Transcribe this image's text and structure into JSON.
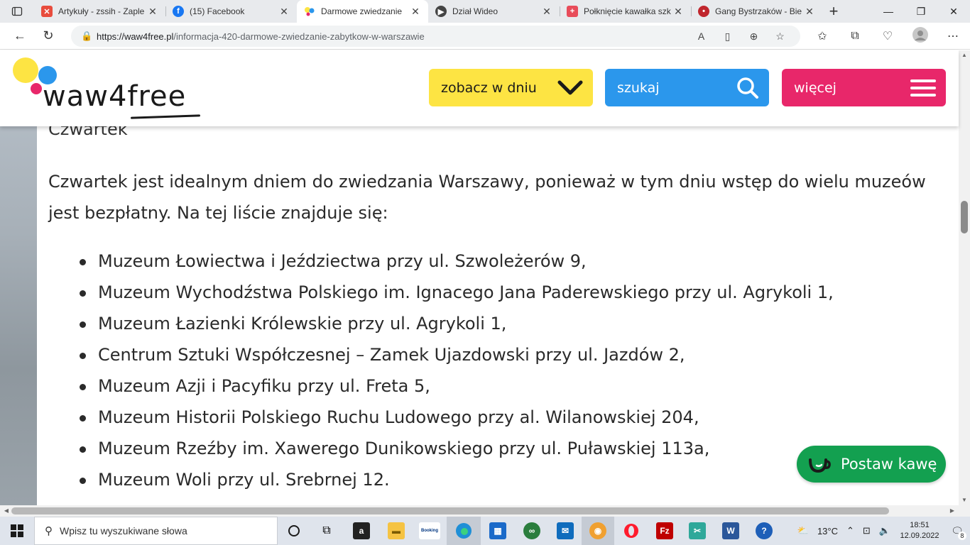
{
  "browser": {
    "tabs": [
      {
        "title": "Artykuły - zssih - Zaple",
        "favicon": "joomla-icon",
        "color": "#e84c3d"
      },
      {
        "title": "(15) Facebook",
        "favicon": "facebook-icon",
        "color": "#1877f2"
      },
      {
        "title": "Darmowe zwiedzanie",
        "favicon": "waw4free-icon",
        "color": "#fde443",
        "active": true
      },
      {
        "title": "Dział Wideo",
        "favicon": "video-icon",
        "color": "#444444"
      },
      {
        "title": "Połknięcie kawałka szk",
        "favicon": "health-icon",
        "color": "#e84c5a"
      },
      {
        "title": "Gang Bystrzaków - Bie",
        "favicon": "ladybug-icon",
        "color": "#c0262d"
      }
    ],
    "url_host": "https://waw4free.pl",
    "url_path": "/informacja-420-darmowe-zwiedzanie-zabytkow-w-warszawie"
  },
  "site": {
    "logo_text": "waw4free",
    "buttons": {
      "date": "zobacz w dniu",
      "search": "szukaj",
      "more": "więcej"
    }
  },
  "article": {
    "heading": "Czwartek",
    "paragraph": "Czwartek jest idealnym dniem do zwiedzania Warszawy, ponieważ w tym dniu wstęp do wielu muzeów jest bezpłatny. Na tej liście znajduje się:",
    "museums": [
      "Muzeum Łowiectwa i Jeździectwa przy ul. Szwoleżerów 9,",
      "Muzeum Wychodźstwa Polskiego im. Ignacego Jana Paderewskiego przy ul. Agrykoli 1,",
      "Muzeum Łazienki Królewskie przy ul. Agrykoli 1,",
      "Centrum Sztuki Współczesnej – Zamek Ujazdowski przy ul. Jazdów 2,",
      "Muzeum Azji i Pacyfiku przy ul. Freta 5,",
      "Muzeum Historii Polskiego Ruchu Ludowego przy al. Wilanowskiej 204,",
      "Muzeum Rzeźby im. Xawerego Dunikowskiego przy ul. Puławskiej 113a,",
      "Muzeum Woli przy ul. Srebrnej 12."
    ]
  },
  "coffee_button": "Postaw kawę",
  "taskbar": {
    "search_placeholder": "Wpisz tu wyszukiwane słowa",
    "weather": "13°C",
    "time": "18:51",
    "date": "12.09.2022",
    "notifications": "8"
  },
  "colors": {
    "yellow": "#fde443",
    "blue": "#2b97ec",
    "pink": "#e8276a",
    "green": "#13a050"
  }
}
